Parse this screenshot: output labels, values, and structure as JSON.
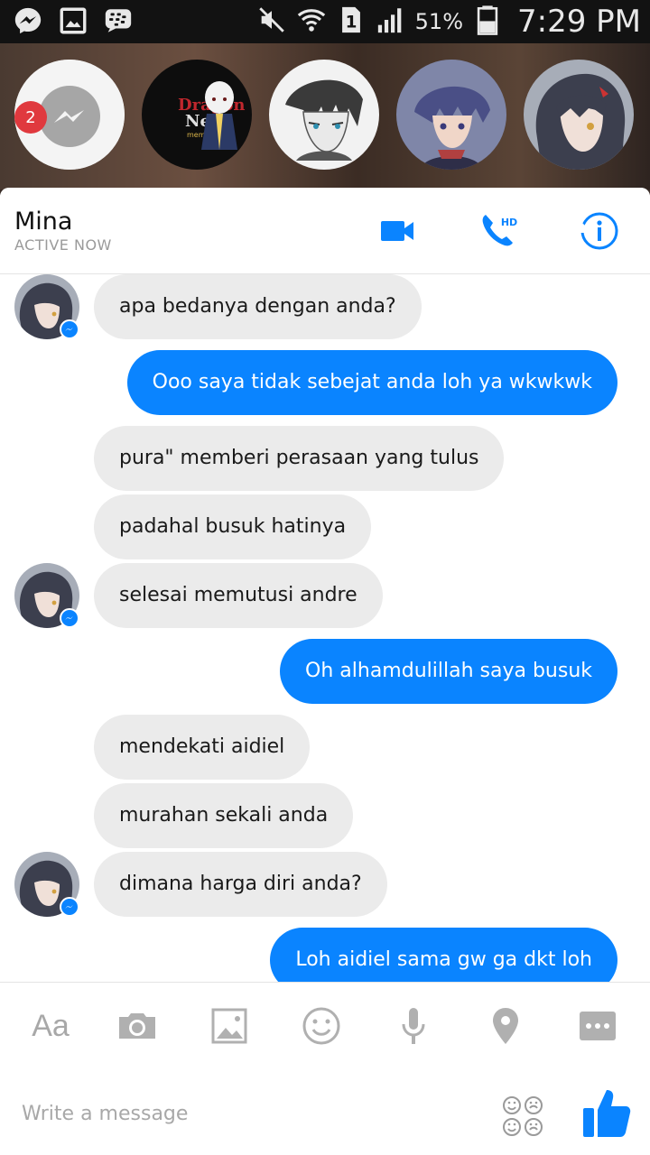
{
  "status_bar": {
    "battery_percent": "51%",
    "time": "7:29 PM",
    "sim_label": "1",
    "icons": [
      "messenger-notification-icon",
      "gallery-notification-icon",
      "blackberry-messenger-icon",
      "vibrate-mute-icon",
      "wifi-icon",
      "sim-icon",
      "signal-icon",
      "battery-icon"
    ]
  },
  "chat_heads": {
    "badge_count": "2",
    "items": [
      "messenger-head",
      "dragon-nest-head",
      "manga-boy-head",
      "anime-boy-head",
      "mina-head"
    ]
  },
  "header": {
    "contact_name": "Mina",
    "contact_status": "ACTIVE NOW",
    "video_call_icon": "video-camera-icon",
    "hd_call_label": "HD",
    "info_icon": "info-icon"
  },
  "messages": [
    {
      "from": "them",
      "text": "apa bedanya dengan anda?"
    },
    {
      "from": "me",
      "text": "Ooo saya tidak sebejat anda loh ya wkwkwk"
    },
    {
      "from": "them",
      "text": "pura\" memberi perasaan yang tulus"
    },
    {
      "from": "them",
      "text": "padahal busuk hatinya"
    },
    {
      "from": "them",
      "text": "selesai memutusi andre"
    },
    {
      "from": "me",
      "text": "Oh alhamdulillah saya busuk"
    },
    {
      "from": "them",
      "text": "mendekati aidiel"
    },
    {
      "from": "them",
      "text": "murahan sekali anda"
    },
    {
      "from": "them",
      "text": "dimana harga diri anda?"
    },
    {
      "from": "me",
      "text": "Loh aidiel sama gw ga dkt loh"
    }
  ],
  "composer": {
    "text_tool_label": "Aa",
    "placeholder": "Write a message",
    "tools": [
      "camera-icon",
      "image-icon",
      "emoji-icon",
      "microphone-icon",
      "location-icon",
      "more-icon"
    ]
  },
  "colors": {
    "accent": "#0a84ff",
    "incoming_bubble": "#ebebeb",
    "badge": "#e0393e"
  }
}
